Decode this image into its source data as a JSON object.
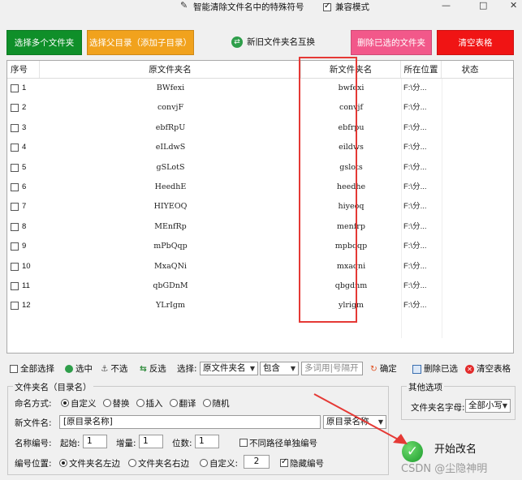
{
  "titlebar": {
    "feature_label": "智能清除文件名中的特殊符号",
    "compat_label": "兼容模式",
    "compat_checked": true,
    "minimize": "—",
    "maximize": "□",
    "close": "✕"
  },
  "toolbar": {
    "select_folders": "选择多个文件夹",
    "select_parent": "选择父目录（添加子目录）",
    "swap_names": "新旧文件夹名互换",
    "delete_selected": "删除已选的文件夹",
    "clear_table": "清空表格"
  },
  "colors": {
    "green": "#0f8f29",
    "orange": "#f1a21d",
    "pink": "#f2588a",
    "red": "#f01414",
    "highlight": "#e53935"
  },
  "table": {
    "headers": [
      "序号",
      "原文件夹名",
      "新文件夹名",
      "所在位置",
      "状态"
    ],
    "rows": [
      {
        "no": "1",
        "original": "BWfexi",
        "new": "bwfexi",
        "location": "F:\\分...",
        "status": ""
      },
      {
        "no": "2",
        "original": "convjF",
        "new": "convjf",
        "location": "F:\\分...",
        "status": ""
      },
      {
        "no": "3",
        "original": "ebfRpU",
        "new": "ebfrpu",
        "location": "F:\\分...",
        "status": ""
      },
      {
        "no": "4",
        "original": "eILdwS",
        "new": "eildws",
        "location": "F:\\分...",
        "status": ""
      },
      {
        "no": "5",
        "original": "gSLotS",
        "new": "gslots",
        "location": "F:\\分...",
        "status": ""
      },
      {
        "no": "6",
        "original": "HeedhE",
        "new": "heedhe",
        "location": "F:\\分...",
        "status": ""
      },
      {
        "no": "7",
        "original": "HIYEOQ",
        "new": "hiyeoq",
        "location": "F:\\分...",
        "status": ""
      },
      {
        "no": "8",
        "original": "MEnfRp",
        "new": "menfrp",
        "location": "F:\\分...",
        "status": ""
      },
      {
        "no": "9",
        "original": "mPbQqp",
        "new": "mpbqqp",
        "location": "F:\\分...",
        "status": ""
      },
      {
        "no": "10",
        "original": "MxaQNi",
        "new": "mxaqni",
        "location": "F:\\分...",
        "status": ""
      },
      {
        "no": "11",
        "original": "qbGDnM",
        "new": "qbgdnm",
        "location": "F:\\分...",
        "status": ""
      },
      {
        "no": "12",
        "original": "YLrIgm",
        "new": "ylrigm",
        "location": "F:\\分...",
        "status": ""
      }
    ]
  },
  "filterbar": {
    "select_all": "全部选择",
    "select": "选中",
    "unselect": "不选",
    "invert": "反选",
    "choose_label": "选择:",
    "field_value": "原文件夹名",
    "match_value": "包含",
    "keyword_placeholder": "多词用|号隔开",
    "confirm": "确定",
    "delete_selected": "删除已选",
    "clear_table": "清空表格"
  },
  "naming": {
    "group_title": "文件夹名（目录名）",
    "mode_label": "命名方式:",
    "modes": [
      "自定义",
      "替换",
      "插入",
      "翻译",
      "随机"
    ],
    "mode_selected": "自定义",
    "new_name_label": "新文件名:",
    "new_name_value": "[原目录名称]",
    "new_name_select": "原目录名称",
    "number_label": "名称编号:",
    "start_label": "起始:",
    "start_value": "1",
    "step_label": "增量:",
    "step_value": "1",
    "digits_label": "位数:",
    "digits_value": "1",
    "independent_label": "不同路径单独编号",
    "independent_checked": false,
    "position_label": "编号位置:",
    "positions": [
      "文件夹名左边",
      "文件夹名右边",
      "自定义:"
    ],
    "position_selected": "文件夹名左边",
    "custom_pos_value": "2",
    "hide_number_label": "隐藏编号",
    "hide_number_checked": true
  },
  "other": {
    "group_title": "其他选项",
    "case_label": "文件夹名字母:",
    "case_value": "全部小写"
  },
  "start_button": "开始改名",
  "watermark": "CSDN @尘隐神明"
}
